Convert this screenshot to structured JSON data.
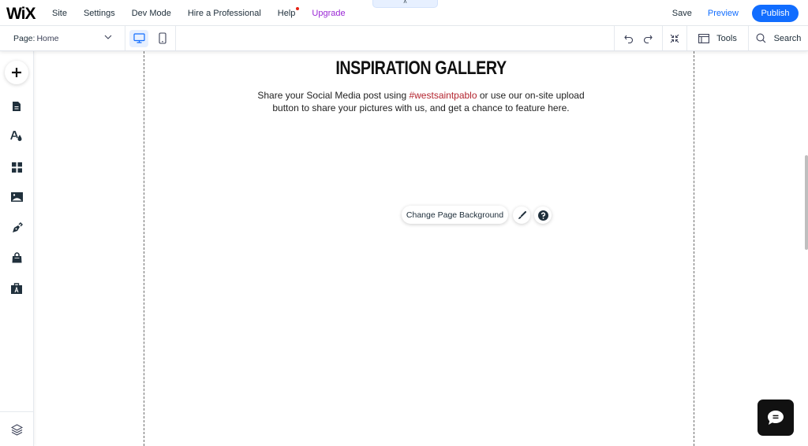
{
  "topbar": {
    "logo": "WiX",
    "menu": [
      {
        "label": "Site"
      },
      {
        "label": "Settings"
      },
      {
        "label": "Dev Mode"
      },
      {
        "label": "Hire a Professional"
      },
      {
        "label": "Help"
      },
      {
        "label": "Upgrade"
      }
    ],
    "collapse_glyph": "˄",
    "save_label": "Save",
    "preview_label": "Preview",
    "publish_label": "Publish"
  },
  "toolbar": {
    "page_label": "Page:",
    "page_value": "Home",
    "devices": [
      "desktop-icon",
      "mobile-icon"
    ],
    "active_device": "desktop",
    "tools_label": "Tools",
    "search_label": "Search"
  },
  "sidebar": {
    "items": [
      {
        "icon": "add-icon",
        "name": "Add Elements"
      },
      {
        "icon": "page-icon",
        "name": "Pages & Menu"
      },
      {
        "icon": "design-icon",
        "name": "Site Design"
      },
      {
        "icon": "apps-icon",
        "name": "Add Apps"
      },
      {
        "icon": "media-icon",
        "name": "Media"
      },
      {
        "icon": "pen-icon",
        "name": "Blog"
      },
      {
        "icon": "store-icon",
        "name": "Store"
      },
      {
        "icon": "portfolio-icon",
        "name": "Portfolio"
      }
    ],
    "bottom_icon": "layers-icon"
  },
  "canvas": {
    "title": "INSPIRATION GALLERY",
    "desc_part1": "Share your Social Media post using ",
    "hashtag": "#westsaintpablo",
    "desc_part2": " or use our on-site upload",
    "desc_line2": "button to share your pictures with us, and get a chance to feature here.",
    "bg_button_label": "Change Page Background",
    "colors": {
      "hashtag": "#b3242e",
      "accent": "#116dff",
      "upgrade": "#9a27d5"
    }
  }
}
